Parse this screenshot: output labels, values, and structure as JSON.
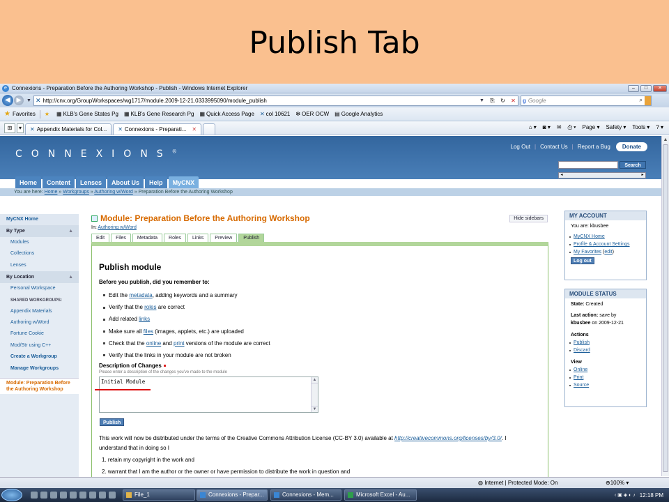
{
  "slide": {
    "title": "Publish Tab"
  },
  "window": {
    "title": "Connexions - Preparation Before the Authoring Workshop - Publish - Windows Internet Explorer"
  },
  "address_bar": {
    "url": "http://cnx.org/GroupWorkspaces/wg1717/module.2009-12-21.0333995090/module_publish",
    "search_placeholder": "Google"
  },
  "favorites_bar": {
    "label": "Favorites",
    "items": [
      "KLB's Gene States Pg",
      "KLB's Gene Research Pg",
      "Quick Access Page",
      "col 10621",
      "OER OCW",
      "Google Analytics"
    ]
  },
  "browser_tabs": [
    {
      "label": "Appendix Materials for Col..."
    },
    {
      "label": "Connexions - Preparati..."
    }
  ],
  "command_bar": [
    "Page ▾",
    "Safety ▾",
    "Tools ▾"
  ],
  "site": {
    "logo": "CONNEXIONS",
    "logo_mark": "®",
    "util_links": [
      "Log Out",
      "Contact Us",
      "Report a Bug"
    ],
    "donate": "Donate",
    "search_button": "Search",
    "nav_tabs": [
      "Home",
      "Content",
      "Lenses",
      "About Us",
      "Help",
      "MyCNX"
    ],
    "breadcrumb": {
      "prefix": "You are here:",
      "items": [
        "Home",
        "Workgroups",
        "Authoring w/Word",
        "Preparation Before the Authoring Workshop"
      ]
    }
  },
  "left_sidebar": {
    "home": "MyCNX Home",
    "by_type": {
      "title": "By Type",
      "items": [
        "Modules",
        "Collections",
        "Lenses"
      ]
    },
    "by_location": {
      "title": "By Location",
      "personal": "Personal Workspace",
      "shared_label": "SHARED WORKGROUPS:",
      "workgroups": [
        "Appendix Materials",
        "Authoring w/Word",
        "Fortune Cookie",
        "Mod/Str using C++"
      ],
      "actions": [
        "Create a Workgroup",
        "Manage Workgroups"
      ]
    },
    "current": "Module: Preparation Before the Authoring Workshop"
  },
  "main": {
    "module_title": "Module: Preparation Before the Authoring Workshop",
    "hide_sidebars": "Hide sidebars",
    "in_label": "In:",
    "in_link": "Authoring w/Word",
    "tabs": [
      "Edit",
      "Files",
      "Metadata",
      "Roles",
      "Links",
      "Preview",
      "Publish"
    ],
    "heading": "Publish module",
    "before": "Before you publish, did you remember to:",
    "checklist": [
      {
        "pre": "Edit the ",
        "link": "metadata",
        "post": ", adding keywords and a summary"
      },
      {
        "pre": "Verify that the ",
        "link": "roles",
        "post": " are correct"
      },
      {
        "pre": "Add related ",
        "link": "links",
        "post": ""
      },
      {
        "pre": "Make sure all ",
        "link": "files",
        "post": " (images, applets, etc.) are uploaded"
      },
      {
        "pre": "Check that the ",
        "link": "online",
        "mid": " and ",
        "link2": "print",
        "post": " versions of the module are correct"
      },
      {
        "pre": "Verify that the links in your module are not broken",
        "link": "",
        "post": ""
      }
    ],
    "desc_label": "Description of Changes",
    "desc_hint": "Please enter a description of the changes you've made to the module",
    "desc_value": "Initial Module",
    "publish_button": "Publish",
    "license_pre": "This work will now be distributed under the terms of the Creative Commons Attribution License (CC-BY 3.0) available at ",
    "license_link": "http://creativecommons.org/licenses/by/3.0/",
    "license_post": ". I understand that in doing so I",
    "license_list": [
      "1.  retain my copyright in the work and",
      "2.  warrant that I am the author or the owner or have permission to distribute the work in question and"
    ]
  },
  "my_account": {
    "title": "MY ACCOUNT",
    "you_are": "You are: kbusbee",
    "links": [
      "MyCNX Home",
      "Profile & Account Settings",
      "My Favorites"
    ],
    "favorites_edit": "edit",
    "logout": "Log out"
  },
  "module_status": {
    "title": "MODULE STATUS",
    "state_label": "State:",
    "state": "Created",
    "last_action_label": "Last action:",
    "last_action": "save by",
    "last_action_user": "kbusbee",
    "last_action_date": "on 2009-12-21",
    "actions_label": "Actions",
    "actions": [
      "Publish",
      "Discard"
    ],
    "view_label": "View",
    "view": [
      "Online",
      "Print",
      "Source"
    ]
  },
  "status_bar": {
    "zone": "Internet | Protected Mode: On",
    "zoom": "100%"
  },
  "taskbar": {
    "items": [
      "File_1",
      "Connexions - Prepar...",
      "Connexions - Mem...",
      "Microsoft Excel - Au..."
    ],
    "clock": "12:18 PM"
  }
}
